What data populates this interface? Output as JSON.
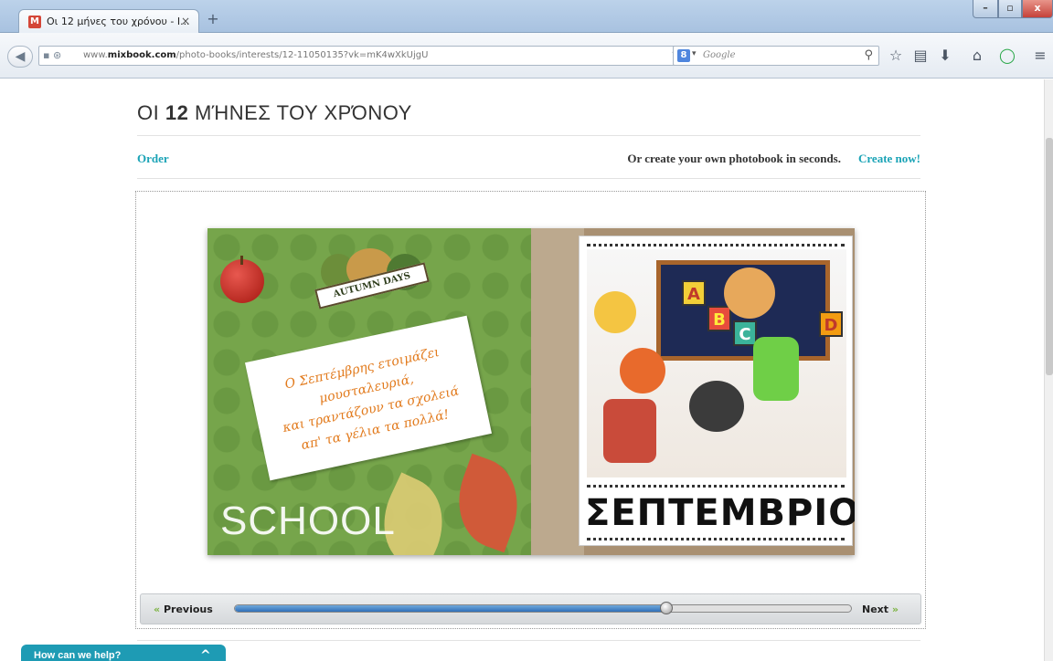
{
  "browser": {
    "tab_title": "Οι 12 μήνες του χρόνου - I...",
    "tab_favicon": "M",
    "tab_close": "×",
    "new_tab": "+",
    "url_domain_prefix": "www.",
    "url_domain": "mixbook.com",
    "url_path": "/photo-books/interests/12-11050135?vk=mK4wXkUjgU",
    "url_right_icons": "▽ C",
    "search_engine": "8",
    "search_arrow": "▾",
    "search_placeholder": "Google",
    "search_glass": "⚲",
    "toolbar_icons": [
      "☆",
      "▤",
      "⬇",
      "⌂",
      "◯",
      "≡"
    ],
    "window_buttons": [
      "–",
      "▫",
      "x"
    ],
    "back_glyph": "◀"
  },
  "page": {
    "title_prefix": "ΟΙ",
    "title_number": "12",
    "title_suffix": "ΜΉΝΕΣ ΤΟΥ ΧΡΌΝΟΥ",
    "order_link": "Order",
    "tagline": "Or create your own photobook in seconds.",
    "create_link": "Create now!"
  },
  "book": {
    "autumn_banner": "AUTUMN DAYS",
    "poem_lines": [
      "Ο Σεπτέμβρης ετοιμάζει",
      "μουσταλευριά,",
      "και τραντάζουν τα σχολειά",
      "απ' τα γέλια τα πολλά!"
    ],
    "school_text": "SCHOOL",
    "month_name": "ΣΕΠΤΕΜΒΡΙΟΣ",
    "board_letters": [
      "A",
      "B",
      "C",
      "D"
    ]
  },
  "viewer": {
    "previous_label": "Previous",
    "next_label": "Next",
    "prev_glyph": "«",
    "next_glyph": "»",
    "progress_fraction": 0.7
  },
  "help_widget": {
    "label": "How can we help?",
    "chevron": "^"
  },
  "colors": {
    "accent": "#1aa3b6",
    "left_page_green": "#76a54b",
    "help_bg": "#1e9bb4"
  }
}
